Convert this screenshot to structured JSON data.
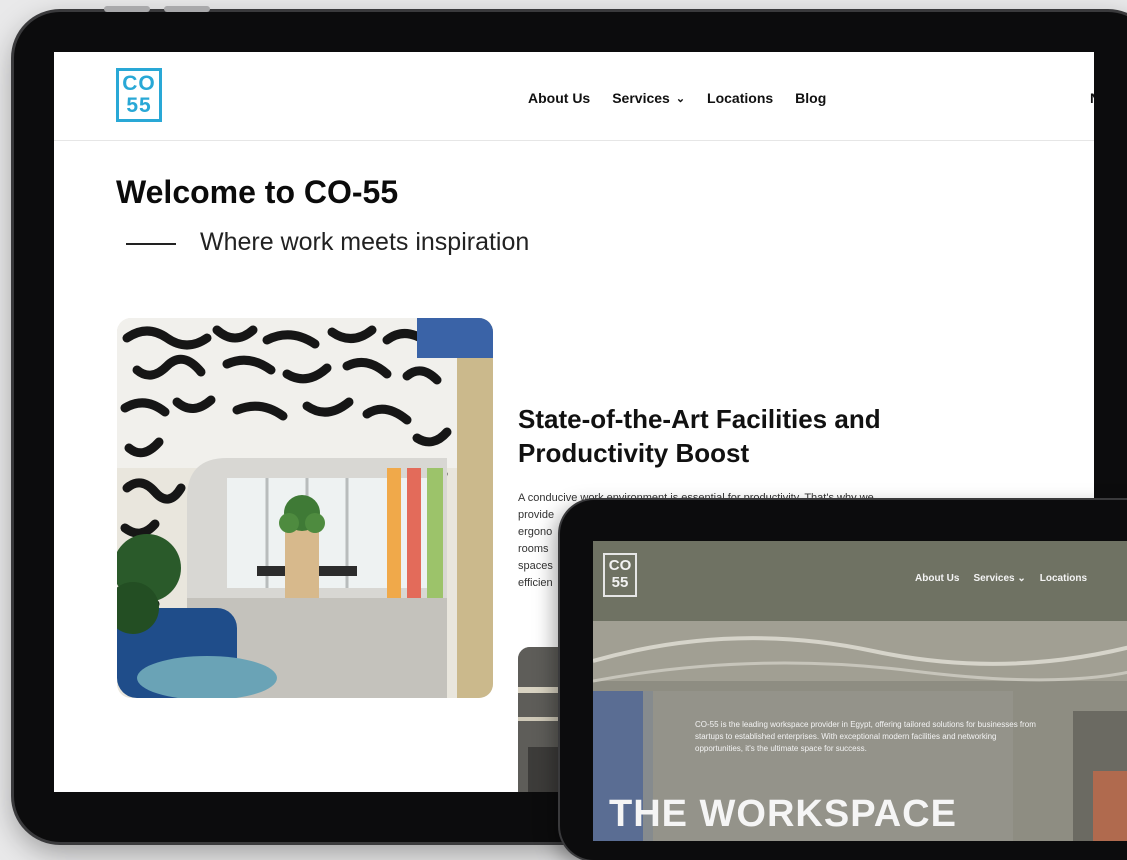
{
  "main_site": {
    "logo_text": [
      "CO",
      "55"
    ],
    "nav": {
      "about": "About Us",
      "services": "Services",
      "locations": "Locations",
      "blog": "Blog",
      "edge_item": "N"
    },
    "title": "Welcome to CO-55",
    "tagline": "Where work meets inspiration",
    "section_title": "State-of-the-Art Facilities and Productivity Boost",
    "section_body_lines": [
      "A conducive work environment is essential for productivity. That's why we",
      "provide",
      "ergono",
      "rooms",
      "spaces",
      "efficien"
    ]
  },
  "secondary_site": {
    "logo_text": [
      "CO",
      "55"
    ],
    "nav": {
      "about": "About Us",
      "services": "Services",
      "locations": "Locations"
    },
    "hero_text": "CO-55 is the leading workspace provider in Egypt, offering tailored solutions for businesses from startups to established enterprises. With exceptional modern facilities and networking opportunities, it's the ultimate space for success.",
    "hero_heading": "THE WORKSPACE"
  },
  "colors": {
    "brand": "#29a8d6",
    "device_frame": "#0c0c0d"
  }
}
